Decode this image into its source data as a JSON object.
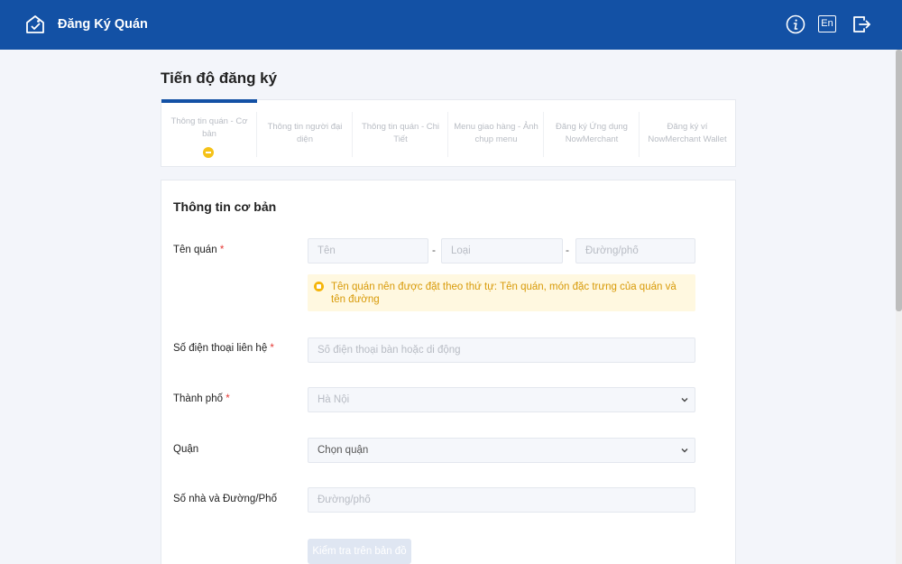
{
  "header": {
    "app_title": "Đăng Ký Quán",
    "lang_label": "En",
    "icons": [
      "store-logo-icon",
      "info-icon",
      "language-icon",
      "logout-icon"
    ],
    "bg_color": "#1351a5"
  },
  "page_title": "Tiến độ đăng ký",
  "steps": [
    {
      "label": "Thông tin quán - Cơ bản",
      "active": true
    },
    {
      "label": "Thông tin người đại diện",
      "active": false
    },
    {
      "label": "Thông tin quán - Chi Tiết",
      "active": false
    },
    {
      "label": "Menu giao hàng - Ảnh chụp menu",
      "active": false
    },
    {
      "label": "Đăng ký Ứng dụng NowMerchant",
      "active": false
    },
    {
      "label": "Đăng ký ví NowMerchant Wallet",
      "active": false
    }
  ],
  "form": {
    "title": "Thông tin cơ bản",
    "required_mark": "*",
    "separator": "-",
    "shop_name": {
      "label": "Tên quán",
      "placeholders": {
        "name": "Tên",
        "type": "Loại",
        "street": "Đường/phố"
      },
      "hint": "Tên quán nên được đặt theo thứ tự: Tên quán, món đặc trưng của quán và tên đường"
    },
    "phone": {
      "label": "Số điện thoại liên hệ",
      "placeholder": "Số điện thoại bàn hoặc di động"
    },
    "city": {
      "label": "Thành phố",
      "value": "Hà Nội"
    },
    "district": {
      "label": "Quận",
      "value": "Chọn quận"
    },
    "address": {
      "label": "Số nhà và Đường/Phố",
      "placeholder": "Đường/phố"
    },
    "map_button": "Kiểm tra trên bản đồ"
  }
}
